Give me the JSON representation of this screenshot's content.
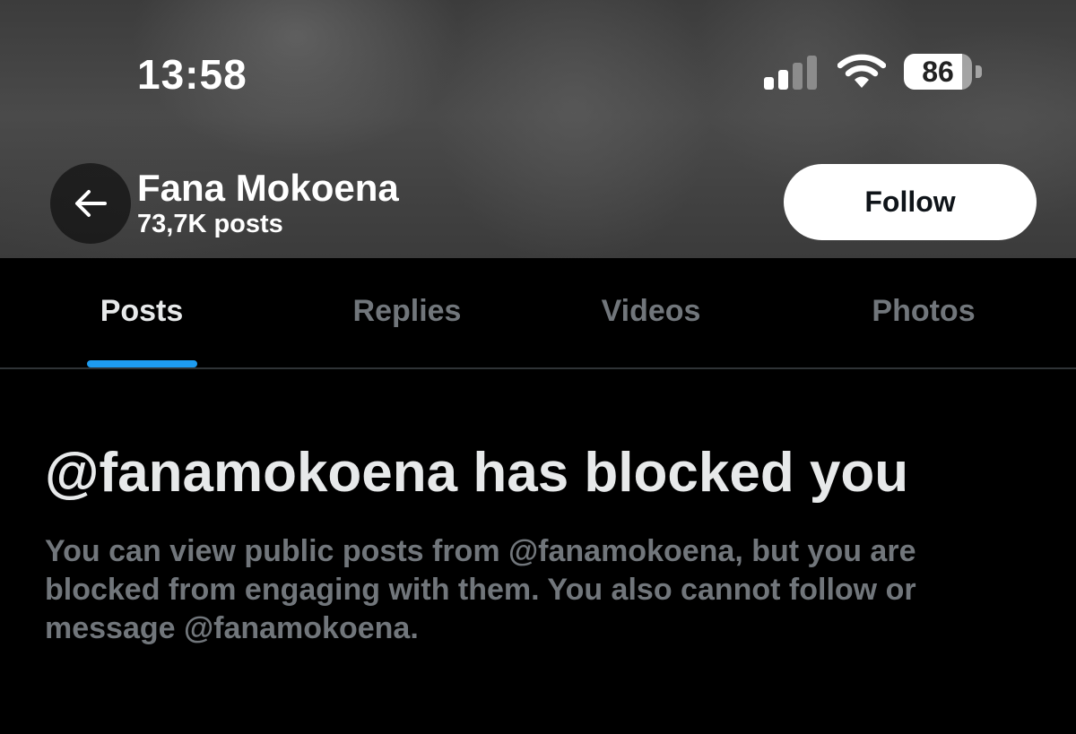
{
  "status_bar": {
    "time": "13:58",
    "battery_level": "86",
    "battery_fraction": 0.86,
    "signal_bars_active": 2,
    "signal_bars_total": 4
  },
  "header": {
    "profile_name": "Fana Mokoena",
    "post_count": "73,7K posts",
    "follow_label": "Follow"
  },
  "tabs": [
    {
      "label": "Posts",
      "active": true
    },
    {
      "label": "Replies",
      "active": false
    },
    {
      "label": "Videos",
      "active": false
    },
    {
      "label": "Photos",
      "active": false
    }
  ],
  "blocked_notice": {
    "title": "@fanamokoena has blocked you",
    "description": "You can view public posts from @fanamokoena, but you are blocked from engaging with them. You also cannot follow or message @fanamokoena."
  },
  "colors": {
    "accent": "#1d9bf0",
    "background": "#000000",
    "muted_text": "#71767b",
    "primary_text": "#e7e9ea"
  },
  "icons": {
    "back": "arrow-left-icon",
    "signal": "cellular-signal-icon",
    "wifi": "wifi-icon",
    "battery": "battery-icon"
  }
}
